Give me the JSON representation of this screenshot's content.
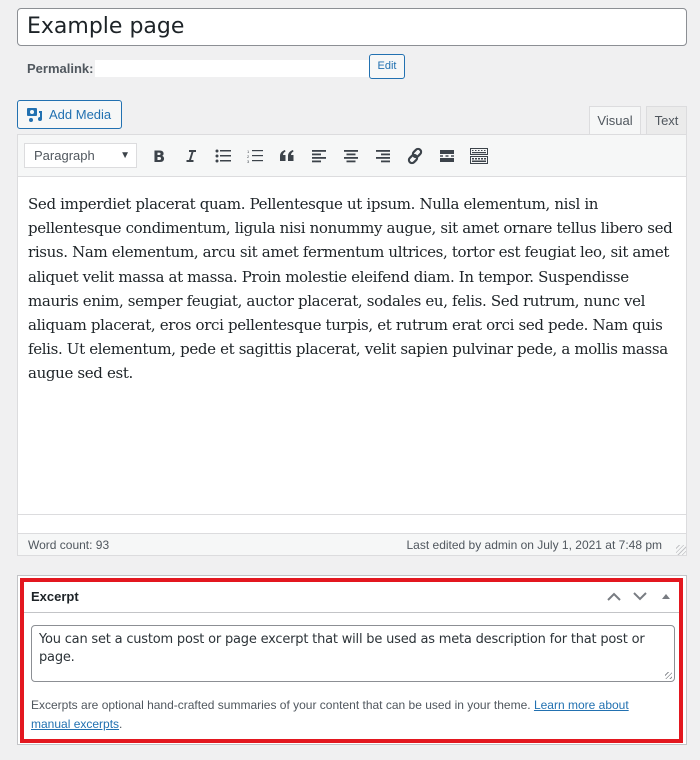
{
  "title": {
    "value": "Example page"
  },
  "permalink": {
    "label": "Permalink:",
    "url": "",
    "edit_label": "Edit"
  },
  "media": {
    "add_media_label": "Add Media"
  },
  "editor_tabs": [
    {
      "label": "Visual",
      "active": true
    },
    {
      "label": "Text",
      "active": false
    }
  ],
  "toolbar": {
    "format_select": "Paragraph",
    "buttons": [
      {
        "name": "bold",
        "icon": "bold-icon"
      },
      {
        "name": "italic",
        "icon": "italic-icon"
      },
      {
        "name": "bulleted-list",
        "icon": "bulleted-list-icon"
      },
      {
        "name": "numbered-list",
        "icon": "numbered-list-icon"
      },
      {
        "name": "blockquote",
        "icon": "blockquote-icon"
      },
      {
        "name": "align-left",
        "icon": "align-left-icon"
      },
      {
        "name": "align-center",
        "icon": "align-center-icon"
      },
      {
        "name": "align-right",
        "icon": "align-right-icon"
      },
      {
        "name": "insert-link",
        "icon": "link-icon"
      },
      {
        "name": "read-more",
        "icon": "read-more-icon"
      },
      {
        "name": "toolbar-toggle",
        "icon": "keyboard-icon"
      }
    ]
  },
  "content": {
    "body": "Sed imperdiet placerat quam. Pellentesque ut ipsum. Nulla elementum, nisl in pellentesque condimentum, ligula nisi nonummy augue, sit amet ornare tellus libero sed risus. Nam elementum, arcu sit amet fermentum ultrices, tortor est feugiat leo, sit amet aliquet velit massa at massa. Proin molestie eleifend diam. In tempor. Suspendisse mauris enim, semper feugiat, auctor placerat, sodales eu, felis. Sed rutrum, nunc vel aliquam placerat, eros orci pellentesque turpis, et rutrum erat orci sed pede. Nam quis felis. Ut elementum, pede et sagittis placerat, velit sapien pulvinar pede, a mollis massa augue sed est."
  },
  "status": {
    "word_count": "Word count: 93",
    "last_edited": "Last edited by admin on July 1, 2021 at 7:48 pm"
  },
  "excerpt": {
    "title": "Excerpt",
    "value": "You can set a custom post or page excerpt that will be used as meta description for that post or page.",
    "help_text": "Excerpts are optional hand-crafted summaries of your content that can be used in your theme.",
    "learn_more_label": "Learn more about manual excerpts",
    "highlight_color": "#e3171f"
  },
  "colors": {
    "accent": "#2271b1",
    "background": "#f0f0f1",
    "highlight": "#e3171f"
  }
}
